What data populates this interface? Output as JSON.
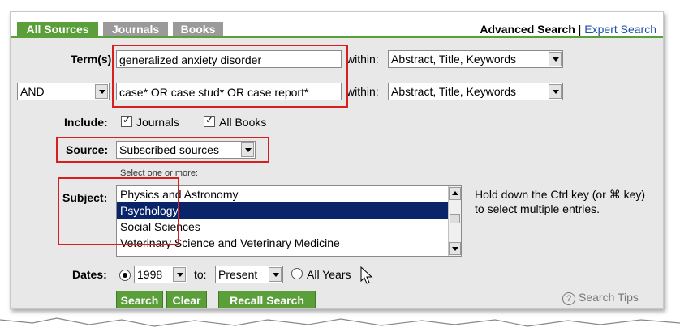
{
  "tabs": [
    {
      "label": "All Sources",
      "active": true
    },
    {
      "label": "Journals",
      "active": false
    },
    {
      "label": "Books",
      "active": false
    }
  ],
  "header_links": {
    "advanced": "Advanced Search",
    "separator": "|",
    "expert": "Expert Search"
  },
  "term1": {
    "label": "Term(s):",
    "value": "generalized anxiety disorder",
    "within_label": "within:",
    "within_value": "Abstract, Title, Keywords"
  },
  "term2": {
    "operator": "AND",
    "value": "case* OR case stud* OR case report*",
    "within_label": "within:",
    "within_value": "Abstract, Title, Keywords"
  },
  "include": {
    "label": "Include:",
    "journals": "Journals",
    "books": "All Books"
  },
  "source": {
    "label": "Source:",
    "value": "Subscribed sources"
  },
  "subject": {
    "label": "Subject:",
    "hint_top": "Select one or more:",
    "options": [
      "Physics and Astronomy",
      "Psychology",
      "Social Sciences",
      "Veterinary Science and Veterinary Medicine"
    ],
    "selected": "Psychology",
    "side_hint": "Hold down the Ctrl key (or ⌘ key) to select multiple entries."
  },
  "dates": {
    "label": "Dates:",
    "from": "1998",
    "to_label": "to:",
    "to": "Present",
    "all_years": "All Years"
  },
  "buttons": {
    "search": "Search",
    "clear": "Clear",
    "recall": "Recall Search"
  },
  "tips": "Search Tips",
  "colors": {
    "accent": "#5b9f3b",
    "highlight_box": "#d61f1f",
    "selection": "#0a246a",
    "link": "#1f4fa6"
  }
}
